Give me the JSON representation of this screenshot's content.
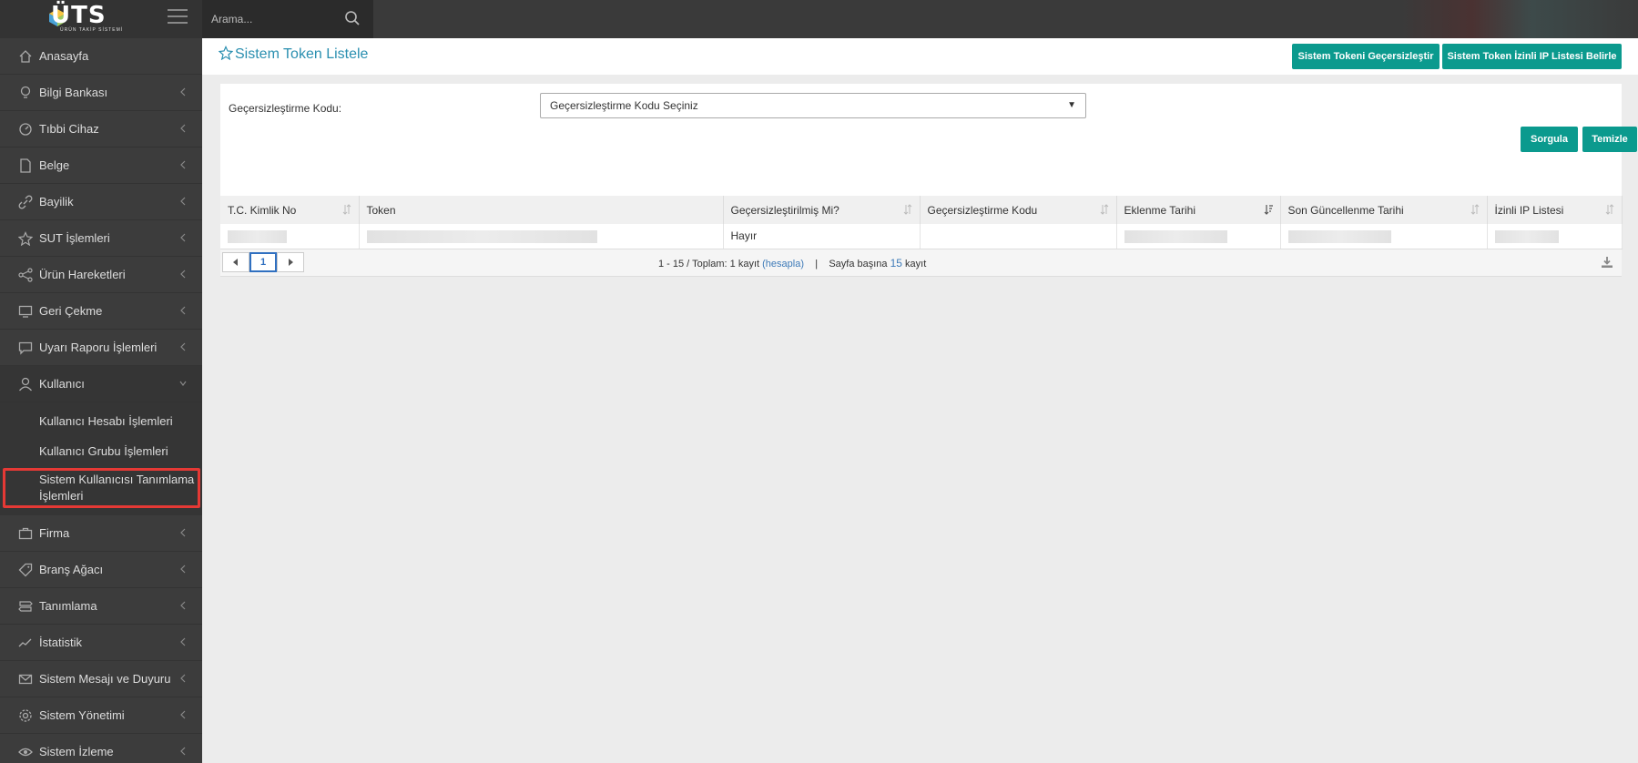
{
  "app": {
    "logo_text": "ÜTS",
    "logo_subtitle": "ÜRÜN TAKİP SİSTEMİ",
    "search_placeholder": "Arama..."
  },
  "sidebar": {
    "items": [
      {
        "label": "Anasayfa",
        "icon": "home-icon"
      },
      {
        "label": "Bilgi Bankası",
        "icon": "lightbulb-icon"
      },
      {
        "label": "Tıbbi Cihaz",
        "icon": "gauge-icon"
      },
      {
        "label": "Belge",
        "icon": "document-icon"
      },
      {
        "label": "Bayilik",
        "icon": "link-icon"
      },
      {
        "label": "SUT İşlemleri",
        "icon": "star-icon"
      },
      {
        "label": "Ürün Hareketleri",
        "icon": "share-icon"
      },
      {
        "label": "Geri Çekme",
        "icon": "monitor-icon"
      },
      {
        "label": "Uyarı Raporu İşlemleri",
        "icon": "comment-icon"
      },
      {
        "label": "Kullanıcı",
        "icon": "user-icon"
      },
      {
        "label": "Firma",
        "icon": "briefcase-icon"
      },
      {
        "label": "Branş Ağacı",
        "icon": "tag-icon"
      },
      {
        "label": "Tanımlama",
        "icon": "signpost-icon"
      },
      {
        "label": "İstatistik",
        "icon": "chart-line-icon"
      },
      {
        "label": "Sistem Mesajı ve Duyuru",
        "icon": "envelope-icon"
      },
      {
        "label": "Sistem Yönetimi",
        "icon": "gear-icon"
      },
      {
        "label": "Sistem İzleme",
        "icon": "eye-icon"
      }
    ],
    "kullanici_sub": [
      "Kullanıcı Hesabı İşlemleri",
      "Kullanıcı Grubu İşlemleri",
      "Sistem Kullanıcısı Tanımlama İşlemleri"
    ]
  },
  "page": {
    "title": "Sistem Token Listele",
    "btn_gecersiz": "Sistem Tokeni Geçersizleştir",
    "btn_izinli": "Sistem Token İzinli IP Listesi Belirle",
    "form_label": "Geçersizleştirme Kodu:",
    "select_value": "Geçersizleştirme Kodu Seçiniz",
    "btn_sorgula": "Sorgula",
    "btn_temizle": "Temizle"
  },
  "table": {
    "headers": [
      "T.C. Kimlik No",
      "Token",
      "Geçersizleştirilmiş Mi?",
      "Geçersizleştirme Kodu",
      "Eklenme Tarihi",
      "Son Güncellenme Tarihi",
      "İzinli IP Listesi"
    ],
    "rows": [
      {
        "gecersiz": "Hayır"
      }
    ]
  },
  "pager": {
    "current_page": "1",
    "range": "1 - 15 / Toplam: 1 kayıt",
    "hesapla": "(hesapla)",
    "separator": "|",
    "per_page_prefix": "Sayfa başına",
    "per_page": "15",
    "per_page_suffix": "kayıt"
  },
  "colors": {
    "accent": "#0b9a8e",
    "title": "#2a8fb0",
    "sidebar_bg": "#3c3c3c",
    "highlight_border": "#e53935"
  }
}
